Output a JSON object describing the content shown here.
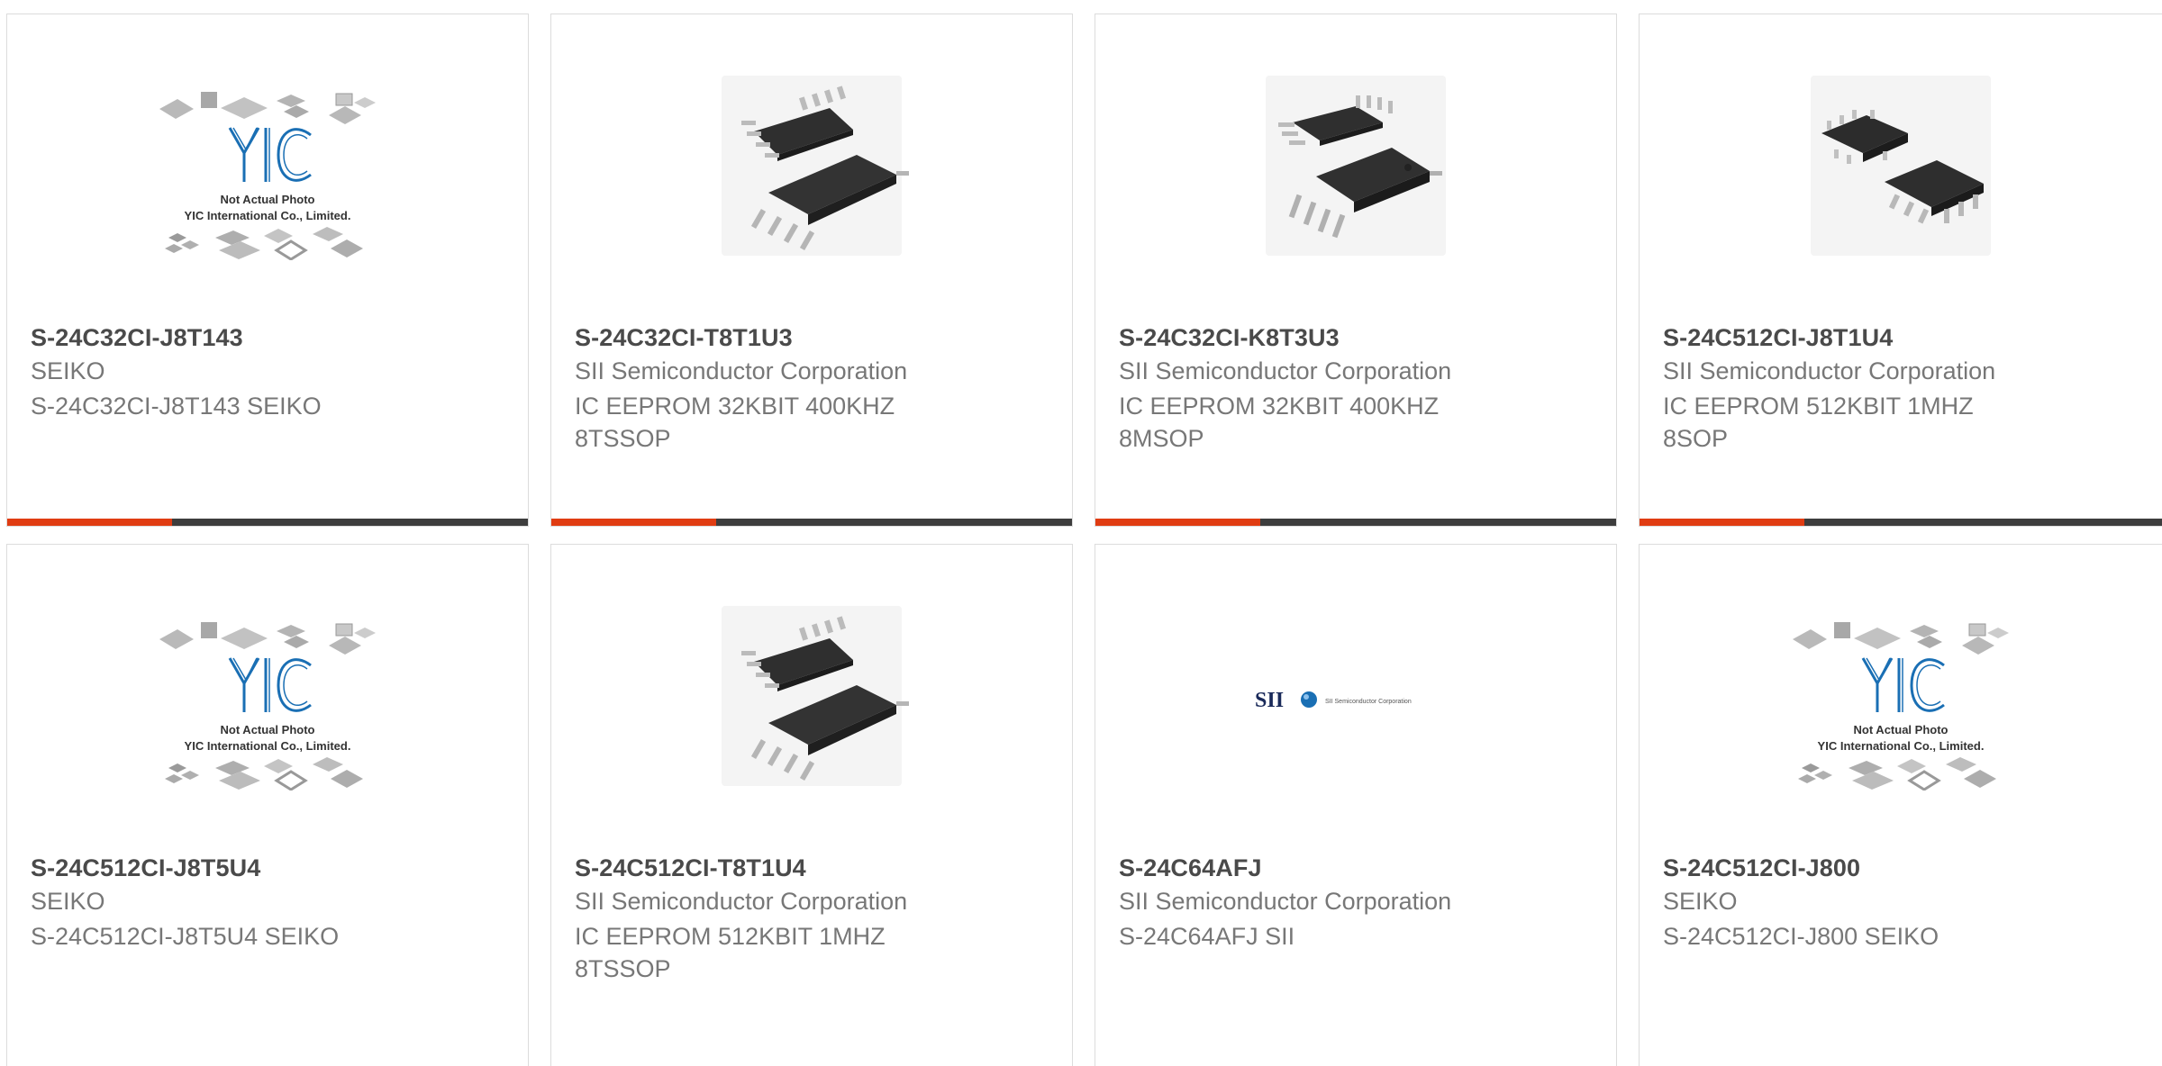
{
  "colors": {
    "accent": "#e03c12",
    "bar": "#3d3d3d",
    "border": "#dcdcdc",
    "title": "#4a4a4a",
    "text": "#777777",
    "yic_blue": "#1a6fb4"
  },
  "placeholder": {
    "line1": "Not Actual Photo",
    "line2": "YIC International Co., Limited.",
    "logo": "YIC"
  },
  "sii_logo": {
    "brand": "SII",
    "tagline": "SII Semiconductor Corporation"
  },
  "products": [
    {
      "part": "S-24C32CI-J8T143",
      "maker": "SEIKO",
      "desc": "S-24C32CI-J8T143 SEIKO",
      "image": "placeholder-image"
    },
    {
      "part": "S-24C32CI-T8T1U3",
      "maker": "SII Semiconductor Corporation",
      "desc": "IC EEPROM 32KBIT 400KHZ\n8TSSOP",
      "image": "tssop-chip-image"
    },
    {
      "part": "S-24C32CI-K8T3U3",
      "maker": "SII Semiconductor Corporation",
      "desc": "IC EEPROM 32KBIT 400KHZ\n8MSOP",
      "image": "msop-chip-image"
    },
    {
      "part": "S-24C512CI-J8T1U4",
      "maker": "SII Semiconductor Corporation",
      "desc": "IC EEPROM 512KBIT 1MHZ\n8SOP",
      "image": "sop-chip-image"
    },
    {
      "part": "S-24C512CI-J8T5U4",
      "maker": "SEIKO",
      "desc": "S-24C512CI-J8T5U4 SEIKO",
      "image": "placeholder-image"
    },
    {
      "part": "S-24C512CI-T8T1U4",
      "maker": "SII Semiconductor Corporation",
      "desc": "IC EEPROM 512KBIT 1MHZ\n8TSSOP",
      "image": "tssop-chip-image"
    },
    {
      "part": "S-24C64AFJ",
      "maker": "SII Semiconductor Corporation",
      "desc": "S-24C64AFJ SII",
      "image": "sii-logo-image"
    },
    {
      "part": "S-24C512CI-J800",
      "maker": "SEIKO",
      "desc": "S-24C512CI-J800 SEIKO",
      "image": "placeholder-image"
    }
  ]
}
